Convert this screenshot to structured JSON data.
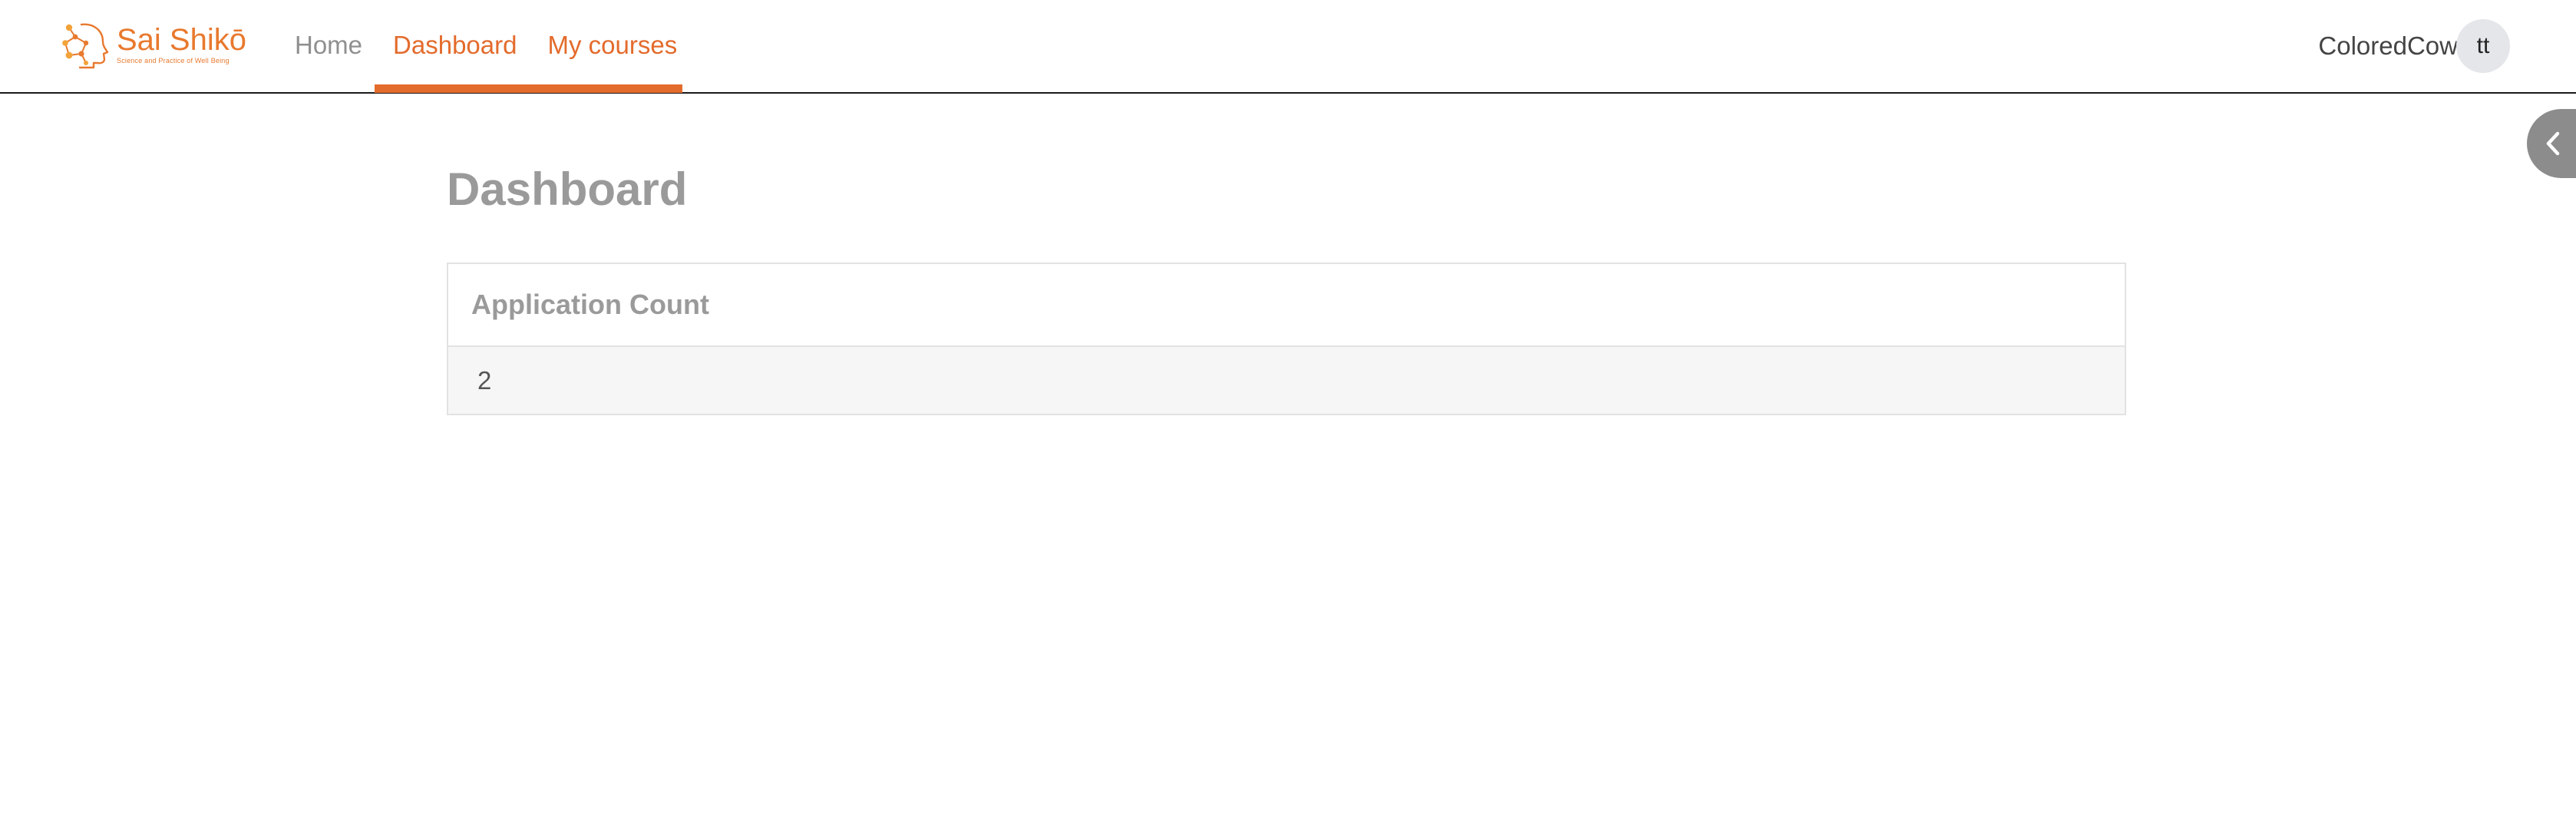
{
  "brand": {
    "name": "Sai Shikō",
    "tagline": "Science and Practice of Well Being",
    "color": "#e8792e"
  },
  "nav": {
    "items": [
      {
        "label": "Home",
        "active": false
      },
      {
        "label": "Dashboard",
        "active": true
      },
      {
        "label": "My courses",
        "active": false
      }
    ],
    "accent_color": "#e36b2c"
  },
  "user": {
    "name": "ColoredCow",
    "initials": "tt"
  },
  "drawer_toggle": {
    "icon": "chevron-left-icon"
  },
  "main": {
    "title": "Dashboard",
    "card": {
      "header": "Application Count",
      "value": "2"
    }
  }
}
